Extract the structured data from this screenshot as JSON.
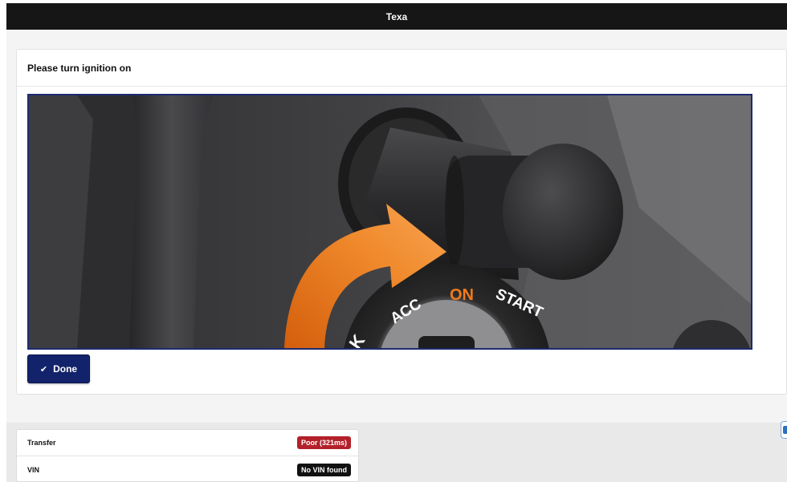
{
  "window": {
    "title": "Texa"
  },
  "dialog": {
    "instruction": "Please turn ignition on",
    "done_label": "Done",
    "done_icon": "check-icon",
    "illustration": {
      "positions": [
        "ACC",
        "ON",
        "START"
      ],
      "active_position": "ON",
      "arrow_color": "#f07a1c",
      "border_color": "#1c2a72"
    }
  },
  "status": {
    "rows": [
      {
        "label": "Transfer",
        "value": "Poor (321ms)",
        "color": "#b3202a"
      },
      {
        "label": "VIN",
        "value": "No VIN found",
        "color": "#111111"
      }
    ]
  },
  "colors": {
    "titlebar": "#161616",
    "accent": "#13236b"
  }
}
